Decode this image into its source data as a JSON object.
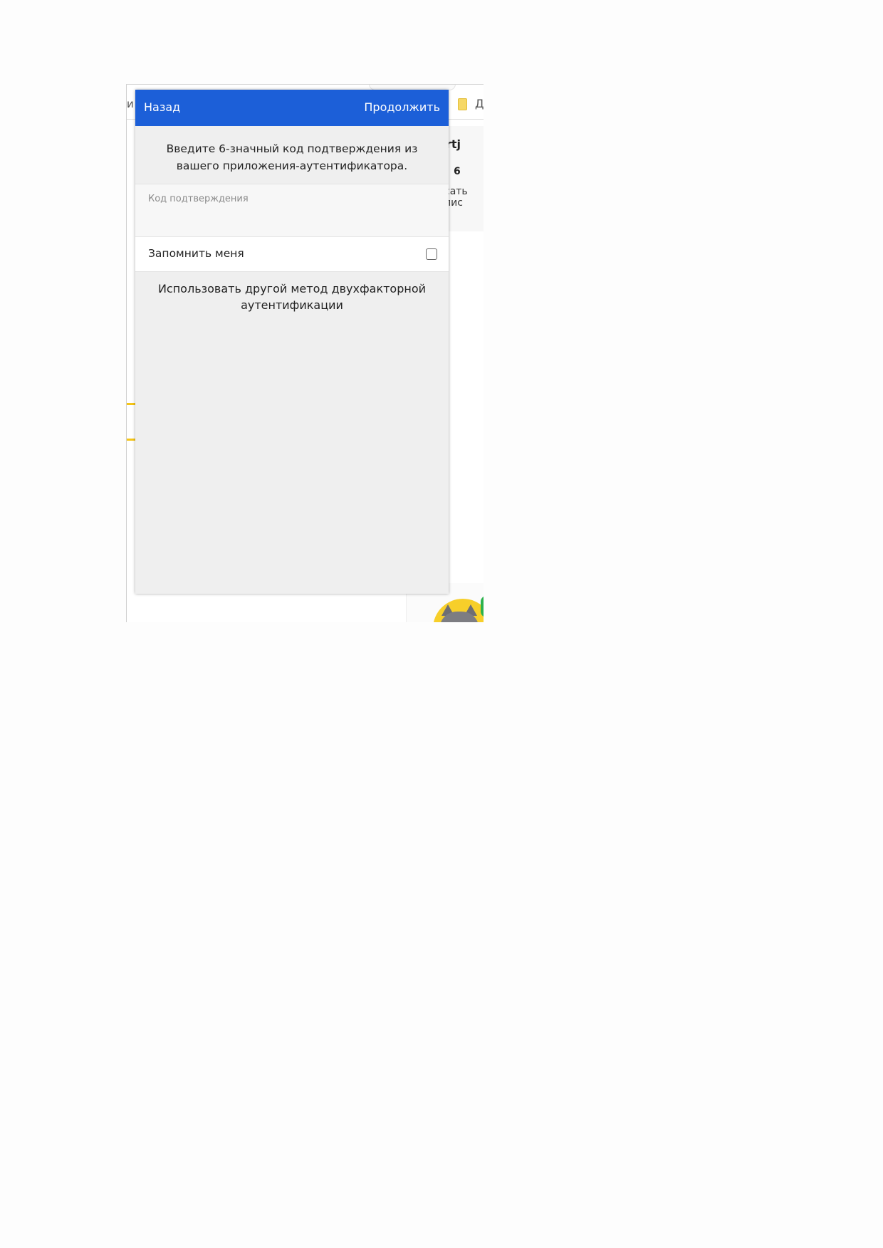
{
  "background": {
    "left_text": "и",
    "folder_label": "Д",
    "name_partial": "rtj",
    "count": "6",
    "write_partial": "сать пис"
  },
  "dialog": {
    "back_label": "Назад",
    "continue_label": "Продолжить",
    "instruction": "Введите 6-значный код подтверждения из вашего приложения-аутентификатора.",
    "code_field": {
      "placeholder": "Код подтверждения",
      "value": ""
    },
    "remember_label": "Запомнить меня",
    "remember_checked": false,
    "alt_method_label": "Использовать другой метод двухфакторной аутентификации"
  },
  "colors": {
    "header_bg": "#1c5fd8",
    "dialog_bg": "#efefef"
  }
}
